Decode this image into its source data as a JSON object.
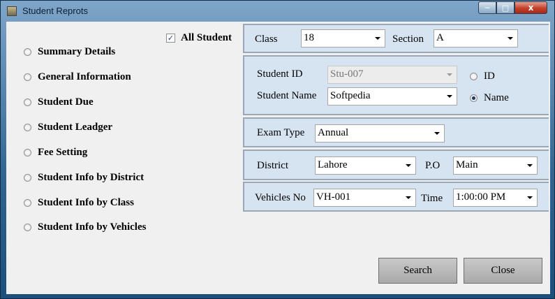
{
  "window": {
    "title": "Student Reprots",
    "close_glyph": "x"
  },
  "report_options": [
    {
      "label": "Summary Details",
      "checked": false
    },
    {
      "label": "General Information",
      "checked": false
    },
    {
      "label": "Student Due",
      "checked": false
    },
    {
      "label": "Student Leadger",
      "checked": false
    },
    {
      "label": "Fee Setting",
      "checked": false
    },
    {
      "label": "Student Info by District",
      "checked": false
    },
    {
      "label": "Student Info by Class",
      "checked": false
    },
    {
      "label": "Student Info by Vehicles",
      "checked": false
    }
  ],
  "all_student": {
    "label": "All Student",
    "checked": true,
    "check_glyph": "✓"
  },
  "class_section": {
    "class_label": "Class",
    "class_value": "18",
    "section_label": "Section",
    "section_value": "A"
  },
  "student": {
    "id_label": "Student ID",
    "id_value": "Stu-007",
    "name_label": "Student Name",
    "name_value": "Softpedia",
    "search_by_id_label": "ID",
    "search_by_name_label": "Name",
    "search_by": "name"
  },
  "exam": {
    "label": "Exam Type",
    "value": "Annual"
  },
  "location": {
    "district_label": "District",
    "district_value": "Lahore",
    "po_label": "P.O",
    "po_value": "Main"
  },
  "transport": {
    "vehicle_label": "Vehicles No",
    "vehicle_value": "VH-001",
    "time_label": "Time",
    "time_value": "1:00:00 PM"
  },
  "actions": {
    "search_label": "Search",
    "close_label": "Close"
  }
}
